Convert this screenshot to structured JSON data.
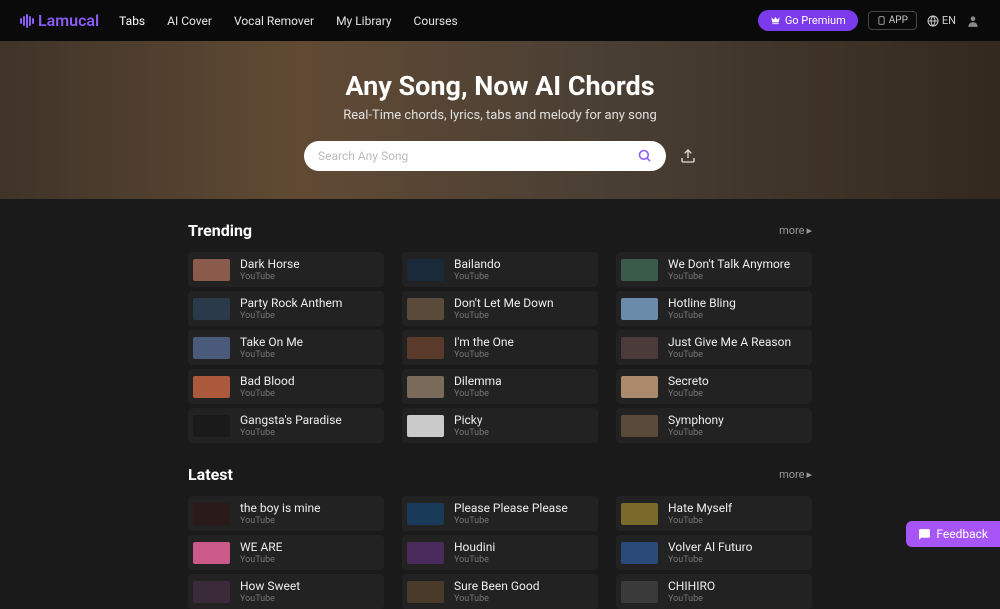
{
  "brand": "Lamucal",
  "nav": {
    "items": [
      {
        "label": "Tabs",
        "active": true
      },
      {
        "label": "AI Cover",
        "active": false
      },
      {
        "label": "Vocal Remover",
        "active": false
      },
      {
        "label": "My Library",
        "active": false
      },
      {
        "label": "Courses",
        "active": false
      }
    ]
  },
  "header": {
    "premium": "Go Premium",
    "app": "APP",
    "lang": "EN"
  },
  "hero": {
    "title": "Any Song, Now AI Chords",
    "subtitle": "Real-Time chords, lyrics, tabs and melody for any song",
    "search_placeholder": "Search Any Song"
  },
  "sections": [
    {
      "title": "Trending",
      "more": "more",
      "songs": [
        {
          "title": "Dark Horse",
          "source": "YouTube",
          "thumb": "#8a5a4a"
        },
        {
          "title": "Bailando",
          "source": "YouTube",
          "thumb": "#1a2a3a"
        },
        {
          "title": "We Don't Talk Anymore",
          "source": "YouTube",
          "thumb": "#3a5a4a"
        },
        {
          "title": "Party Rock Anthem",
          "source": "YouTube",
          "thumb": "#2a3a4a"
        },
        {
          "title": "Don't Let Me Down",
          "source": "YouTube",
          "thumb": "#5a4a3a"
        },
        {
          "title": "Hotline Bling",
          "source": "YouTube",
          "thumb": "#6a8aaa"
        },
        {
          "title": "Take On Me",
          "source": "YouTube",
          "thumb": "#4a5a7a"
        },
        {
          "title": "I'm the One",
          "source": "YouTube",
          "thumb": "#5a3a2a"
        },
        {
          "title": "Just Give Me A Reason",
          "source": "YouTube",
          "thumb": "#4a3a3a"
        },
        {
          "title": "Bad Blood",
          "source": "YouTube",
          "thumb": "#aa5a3a"
        },
        {
          "title": "Dilemma",
          "source": "YouTube",
          "thumb": "#7a6a5a"
        },
        {
          "title": "Secreto",
          "source": "YouTube",
          "thumb": "#aa8a6a"
        },
        {
          "title": "Gangsta's Paradise",
          "source": "YouTube",
          "thumb": "#1a1a1a"
        },
        {
          "title": "Picky",
          "source": "YouTube",
          "thumb": "#cacaca"
        },
        {
          "title": "Symphony",
          "source": "YouTube",
          "thumb": "#5a4a3a"
        }
      ]
    },
    {
      "title": "Latest",
      "more": "more",
      "songs": [
        {
          "title": "the boy is mine",
          "source": "YouTube",
          "thumb": "#2a1a1a"
        },
        {
          "title": "Please Please Please",
          "source": "YouTube",
          "thumb": "#1a3a5a"
        },
        {
          "title": "Hate Myself",
          "source": "YouTube",
          "thumb": "#7a6a2a"
        },
        {
          "title": "WE ARE",
          "source": "YouTube",
          "thumb": "#ca5a8a"
        },
        {
          "title": "Houdini",
          "source": "YouTube",
          "thumb": "#4a2a5a"
        },
        {
          "title": "Volver Al Futuro",
          "source": "YouTube",
          "thumb": "#2a4a7a"
        },
        {
          "title": "How Sweet",
          "source": "YouTube",
          "thumb": "#3a2a3a"
        },
        {
          "title": "Sure Been Good",
          "source": "YouTube",
          "thumb": "#4a3a2a"
        },
        {
          "title": "CHIHIRO",
          "source": "YouTube",
          "thumb": "#3a3a3a"
        }
      ]
    }
  ],
  "feedback": "Feedback"
}
